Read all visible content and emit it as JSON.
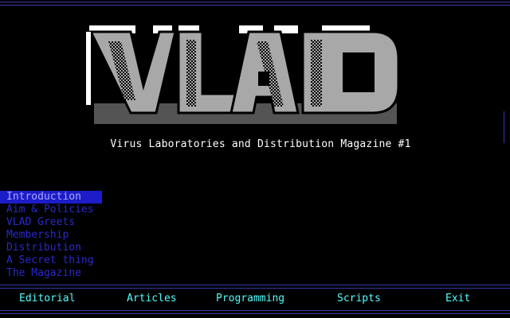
{
  "title": "VLAD",
  "subtitle": "Virus Laboratories and Distribution Magazine #1",
  "menu": {
    "items": [
      {
        "label": "Introduction",
        "selected": true
      },
      {
        "label": "Aim & Policies",
        "selected": false
      },
      {
        "label": "VLAD Greets",
        "selected": false
      },
      {
        "label": "Membership",
        "selected": false
      },
      {
        "label": "Distribution",
        "selected": false
      },
      {
        "label": "A Secret thing",
        "selected": false
      },
      {
        "label": "The Magazine",
        "selected": false
      }
    ]
  },
  "bottom_bar": {
    "items": [
      {
        "label": "Editorial"
      },
      {
        "label": "Articles"
      },
      {
        "label": "Programming"
      },
      {
        "label": "Scripts"
      },
      {
        "label": "Exit"
      }
    ]
  },
  "colors": {
    "background": "#000000",
    "frame": "#3838a8",
    "menu_text": "#2a2acc",
    "menu_selected_bg": "#1c1cc8",
    "menu_selected_text": "#a8a8ff",
    "bottom_text": "#54fcfc",
    "subtitle_text": "#ffffff"
  }
}
